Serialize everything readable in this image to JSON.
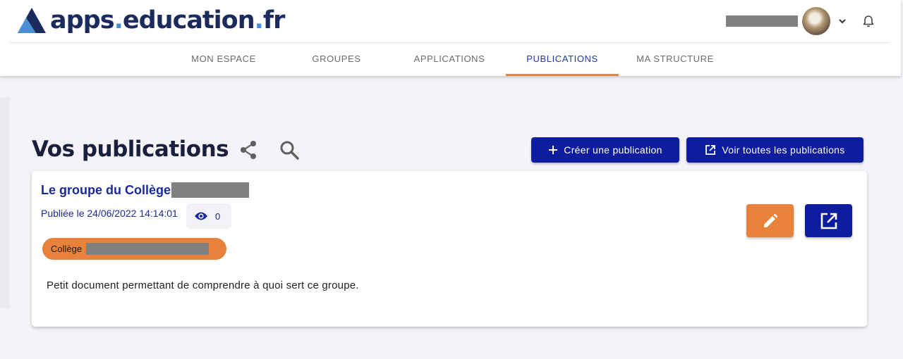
{
  "header": {
    "logo": {
      "part1": "apps",
      "dot1": ".",
      "part2": "education",
      "dot2": ".",
      "part3": "fr"
    },
    "user": {
      "name_redacted": true,
      "avatar_icon": "avatar-photo"
    },
    "icons": {
      "chevron": "chevron-down-icon",
      "notifications": "bell-icon"
    }
  },
  "nav": {
    "items": [
      {
        "label": "MON ESPACE"
      },
      {
        "label": "GROUPES"
      },
      {
        "label": "APPLICATIONS"
      },
      {
        "label": "PUBLICATIONS",
        "active": true
      },
      {
        "label": "MA STRUCTURE"
      }
    ]
  },
  "main": {
    "title": "Vos publications",
    "create_button": "Créer une publication",
    "view_all_button": "Voir toutes les publications"
  },
  "publication": {
    "title": "Le groupe du Collège",
    "published": "Publiée le 24/06/2022 14:14:01",
    "views": "0",
    "tag": "Collège",
    "description": "Petit document permettant de comprendre à quoi sert ce groupe."
  },
  "colors": {
    "brand_navy": "#1c2b5e",
    "primary_button": "#0e1da0",
    "accent_orange": "#e8823a",
    "link_blue": "#1a2a9a",
    "background": "#f4f4f8"
  }
}
